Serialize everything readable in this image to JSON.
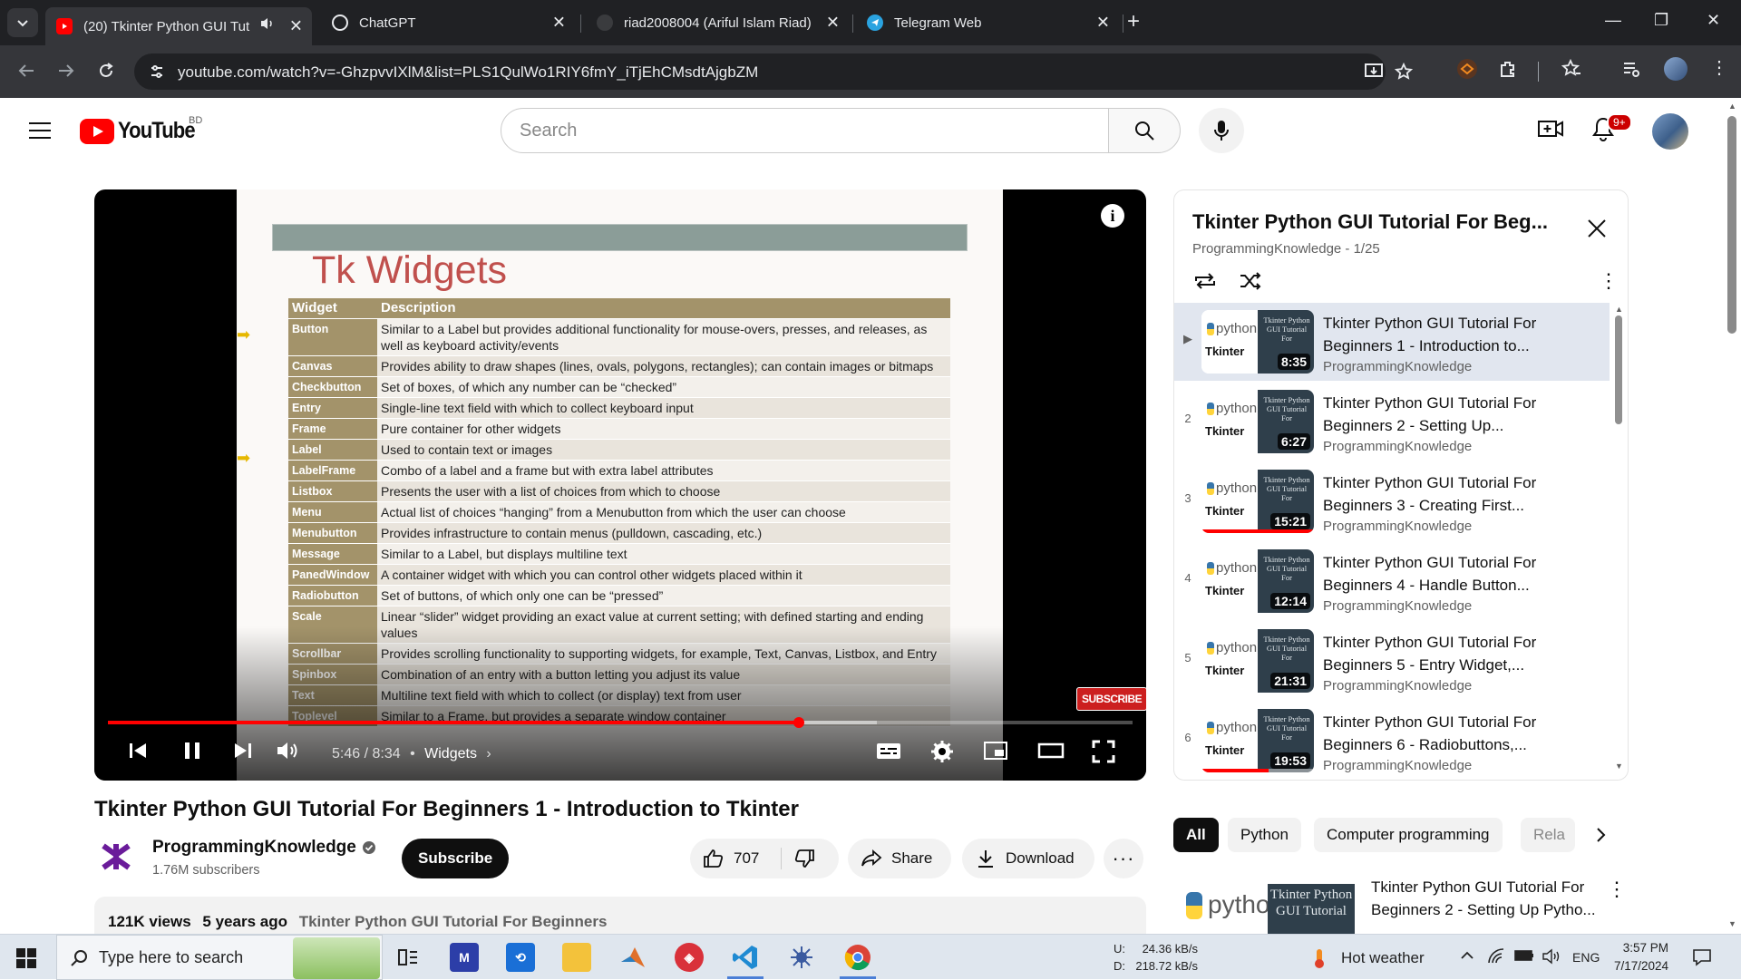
{
  "browser": {
    "tabs": [
      {
        "title": "(20) Tkinter Python GUI Tut",
        "active": true
      },
      {
        "title": "ChatGPT",
        "active": false
      },
      {
        "title": "riad2008004 (Ariful Islam Riad)",
        "active": false
      },
      {
        "title": "Telegram Web",
        "active": false
      }
    ],
    "url": "youtube.com/watch?v=-GhzpvvIXlM&list=PLS1QulWo1RIY6fmY_iTjEhCMsdtAjgbZM"
  },
  "youtube": {
    "logo_text": "YouTube",
    "country_code": "BD",
    "search_placeholder": "Search",
    "notification_count": "9+"
  },
  "player": {
    "slide_heading": "Tk Widgets",
    "table_headers": [
      "Widget",
      "Description"
    ],
    "widgets": [
      {
        "name": "Button",
        "desc": "Similar to a Label but provides additional functionality for mouse-overs, presses, and releases, as well as keyboard activity/events"
      },
      {
        "name": "Canvas",
        "desc": "Provides ability to draw shapes (lines, ovals, polygons, rectangles); can contain images or bitmaps"
      },
      {
        "name": "Checkbutton",
        "desc": "Set of boxes, of which any number can be “checked”"
      },
      {
        "name": "Entry",
        "desc": "Single-line text field with which to collect keyboard input"
      },
      {
        "name": "Frame",
        "desc": "Pure container for other widgets"
      },
      {
        "name": "Label",
        "desc": "Used to contain text or images"
      },
      {
        "name": "LabelFrame",
        "desc": "Combo of a label and a frame but with extra label attributes"
      },
      {
        "name": "Listbox",
        "desc": "Presents the user with a list of choices from which to choose"
      },
      {
        "name": "Menu",
        "desc": "Actual list of choices “hanging” from a Menubutton from which the user can choose"
      },
      {
        "name": "Menubutton",
        "desc": "Provides infrastructure to contain menus (pulldown, cascading, etc.)"
      },
      {
        "name": "Message",
        "desc": "Similar to a Label, but displays multiline text"
      },
      {
        "name": "PanedWindow",
        "desc": "A container widget with which you can control other widgets placed within it"
      },
      {
        "name": "Radiobutton",
        "desc": "Set of buttons, of which only one can be “pressed”"
      },
      {
        "name": "Scale",
        "desc": "Linear “slider” widget providing an exact value at current setting; with defined starting and ending values"
      },
      {
        "name": "Scrollbar",
        "desc": "Provides scrolling functionality to supporting widgets, for example, Text, Canvas, Listbox, and Entry"
      },
      {
        "name": "Spinbox",
        "desc": "Combination of an entry with a button letting you adjust its value"
      },
      {
        "name": "Text",
        "desc": "Multiline text field with which to collect (or display) text from user"
      },
      {
        "name": "Toplevel",
        "desc": "Similar to a Frame, but provides a separate window container"
      }
    ],
    "subscribe_watermark": "SUBSCRIBE",
    "current_time": "5:46",
    "duration": "8:34",
    "time_display": "5:46 / 8:34",
    "chapter": "Widgets",
    "progress_fraction": 0.674,
    "buffered_fraction": 0.75
  },
  "video": {
    "title": "Tkinter Python GUI Tutorial For Beginners 1 - Introduction to Tkinter",
    "channel": "ProgrammingKnowledge",
    "subscribers": "1.76M subscribers",
    "subscribe_label": "Subscribe",
    "likes": "707",
    "share_label": "Share",
    "download_label": "Download",
    "views": "121K views",
    "age": "5 years ago",
    "playlist_tag": "Tkinter Python GUI Tutorial For Beginners"
  },
  "playlist": {
    "title": "Tkinter Python GUI Tutorial For Beg...",
    "subtitle": "ProgrammingKnowledge - 1/25",
    "items": [
      {
        "index": "▶",
        "title": "Tkinter Python GUI Tutorial For Beginners 1 - Introduction to...",
        "channel": "ProgrammingKnowledge",
        "duration": "8:35",
        "watched": 0.0,
        "current": true
      },
      {
        "index": "2",
        "title": "Tkinter Python GUI Tutorial For Beginners 2 - Setting Up...",
        "channel": "ProgrammingKnowledge",
        "duration": "6:27",
        "watched": 0.0,
        "current": false
      },
      {
        "index": "3",
        "title": "Tkinter Python GUI Tutorial For Beginners 3 - Creating First...",
        "channel": "ProgrammingKnowledge",
        "duration": "15:21",
        "watched": 1.0,
        "current": false
      },
      {
        "index": "4",
        "title": "Tkinter Python GUI Tutorial For Beginners 4 - Handle Button...",
        "channel": "ProgrammingKnowledge",
        "duration": "12:14",
        "watched": 0.0,
        "current": false
      },
      {
        "index": "5",
        "title": "Tkinter Python GUI Tutorial For Beginners 5 - Entry Widget,...",
        "channel": "ProgrammingKnowledge",
        "duration": "21:31",
        "watched": 0.0,
        "current": false
      },
      {
        "index": "6",
        "title": "Tkinter Python GUI Tutorial For Beginners 6 - Radiobuttons,...",
        "channel": "ProgrammingKnowledge",
        "duration": "19:53",
        "watched": 0.6,
        "current": false
      }
    ],
    "thumb_python": "python",
    "thumb_tkinter": "Tkinter",
    "thumb_right_text": "Tkinter Python GUI Tutorial For"
  },
  "chips": [
    "All",
    "Python",
    "Computer programming",
    "Rela"
  ],
  "recommendation": {
    "title": "Tkinter Python GUI Tutorial For Beginners 2 - Setting Up Pytho...",
    "thumb_python": "python",
    "thumb_text": "Tkinter Python GUI Tutorial"
  },
  "taskbar": {
    "search_placeholder": "Type here to search",
    "upload_label": "U:",
    "upload_speed": "24.36 kB/s",
    "download_label": "D:",
    "download_speed": "218.72 kB/s",
    "weather": "Hot weather",
    "language": "ENG",
    "time": "3:57 PM",
    "date": "7/17/2024"
  },
  "colors": {
    "youtube_red": "#ff0000",
    "slide_heading": "#c0504d",
    "table_header": "#a3936a"
  }
}
